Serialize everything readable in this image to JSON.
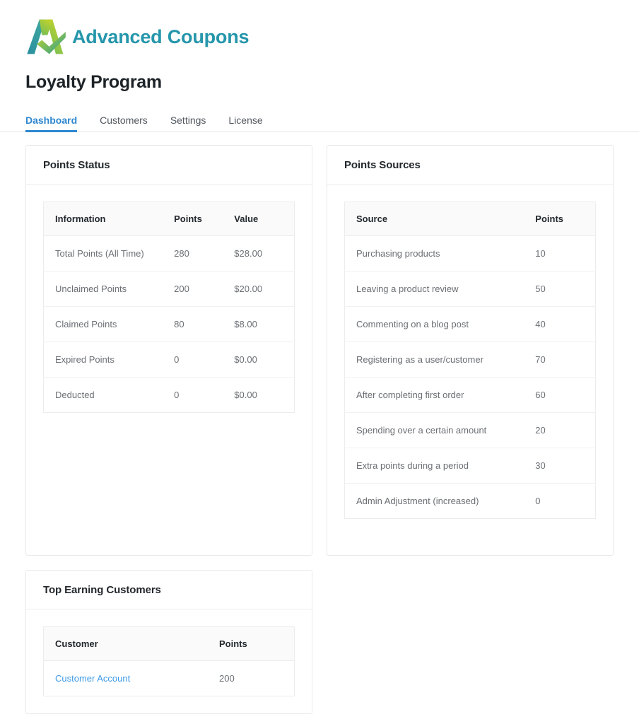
{
  "brand": {
    "logo_icon": "advanced-coupons-a-mark",
    "name": "Advanced Coupons",
    "colors": {
      "teal": "#2596ab",
      "leaf_green": "#a9c93c",
      "deep_teal": "#2a8f9e"
    }
  },
  "page": {
    "title": "Loyalty Program",
    "accent": "#2e87d0",
    "link_color": "#3d9ae8"
  },
  "tabs": [
    {
      "label": "Dashboard",
      "active": true
    },
    {
      "label": "Customers",
      "active": false
    },
    {
      "label": "Settings",
      "active": false
    },
    {
      "label": "License",
      "active": false
    }
  ],
  "points_status": {
    "title": "Points Status",
    "columns": [
      "Information",
      "Points",
      "Value"
    ],
    "rows": [
      {
        "information": "Total Points (All Time)",
        "points": "280",
        "value": "$28.00"
      },
      {
        "information": "Unclaimed Points",
        "points": "200",
        "value": "$20.00"
      },
      {
        "information": "Claimed Points",
        "points": "80",
        "value": "$8.00"
      },
      {
        "information": "Expired Points",
        "points": "0",
        "value": "$0.00"
      },
      {
        "information": "Deducted",
        "points": "0",
        "value": "$0.00"
      }
    ]
  },
  "points_sources": {
    "title": "Points Sources",
    "columns": [
      "Source",
      "Points"
    ],
    "rows": [
      {
        "source": "Purchasing products",
        "points": "10"
      },
      {
        "source": "Leaving a product review",
        "points": "50"
      },
      {
        "source": "Commenting on a blog post",
        "points": "40"
      },
      {
        "source": "Registering as a user/customer",
        "points": "70"
      },
      {
        "source": "After completing first order",
        "points": "60"
      },
      {
        "source": "Spending over a certain amount",
        "points": "20"
      },
      {
        "source": "Extra points during a period",
        "points": "30"
      },
      {
        "source": "Admin Adjustment (increased)",
        "points": "0"
      }
    ]
  },
  "top_earning_customers": {
    "title": "Top Earning Customers",
    "columns": [
      "Customer",
      "Points"
    ],
    "rows": [
      {
        "customer": "Customer Account",
        "points": "200"
      }
    ]
  }
}
